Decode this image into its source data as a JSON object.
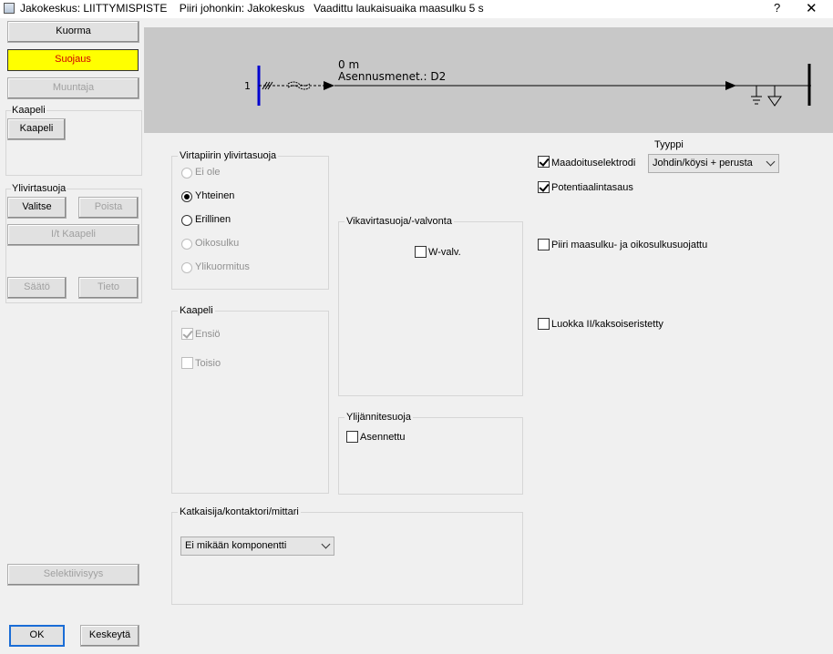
{
  "window": {
    "title": "Jakokeskus: LIITTYMISPISTE    Piiri johonkin: Jakokeskus   Vaadittu laukaisuaika maasulku 5 s",
    "help": "?",
    "close": "✕"
  },
  "left": {
    "kuorma": "Kuorma",
    "suojaus": "Suojaus",
    "muuntaja": "Muuntaja",
    "kaapeli_group": "Kaapeli",
    "kaapeli_btn": "Kaapeli",
    "ylivirtasuoja_group": "Ylivirtasuoja",
    "valitse": "Valitse",
    "poista": "Poista",
    "it_kaapeli": "I/t Kaapeli",
    "saato": "Säätö",
    "tieto": "Tieto",
    "selektiivisyys": "Selektiivisyys",
    "ok": "OK",
    "keskeyta": "Keskeytä"
  },
  "diagram": {
    "node_number": "1",
    "length": "0 m",
    "install": "Asennusmenet.: D2"
  },
  "virtapiiri": {
    "title": "Virtapiirin ylivirtasuoja",
    "options": [
      "Ei ole",
      "Yhteinen",
      "Erillinen",
      "Oikosulku",
      "Ylikuormitus"
    ]
  },
  "kaapeli": {
    "title": "Kaapeli",
    "ensio": "Ensiö",
    "toisio": "Toisio"
  },
  "vikavirta": {
    "title": "Vikavirtasuoja/-valvonta",
    "wvalv": "W-valv."
  },
  "ylijannite": {
    "title": "Ylijännitesuoja",
    "asennettu": "Asennettu"
  },
  "katkaisija": {
    "title": "Katkaisija/kontaktori/mittari",
    "selected": "Ei mikään komponentti"
  },
  "right": {
    "tyyppi_label": "Tyyppi",
    "maadoitus": "Maadoituselektrodi",
    "tyyppi_value": "Johdin/köysi + perusta",
    "potentiaali": "Potentiaalintasaus",
    "piiri": "Piiri maasulku- ja oikosulkusuojattu",
    "luokka": "Luokka II/kaksoiseristetty"
  }
}
